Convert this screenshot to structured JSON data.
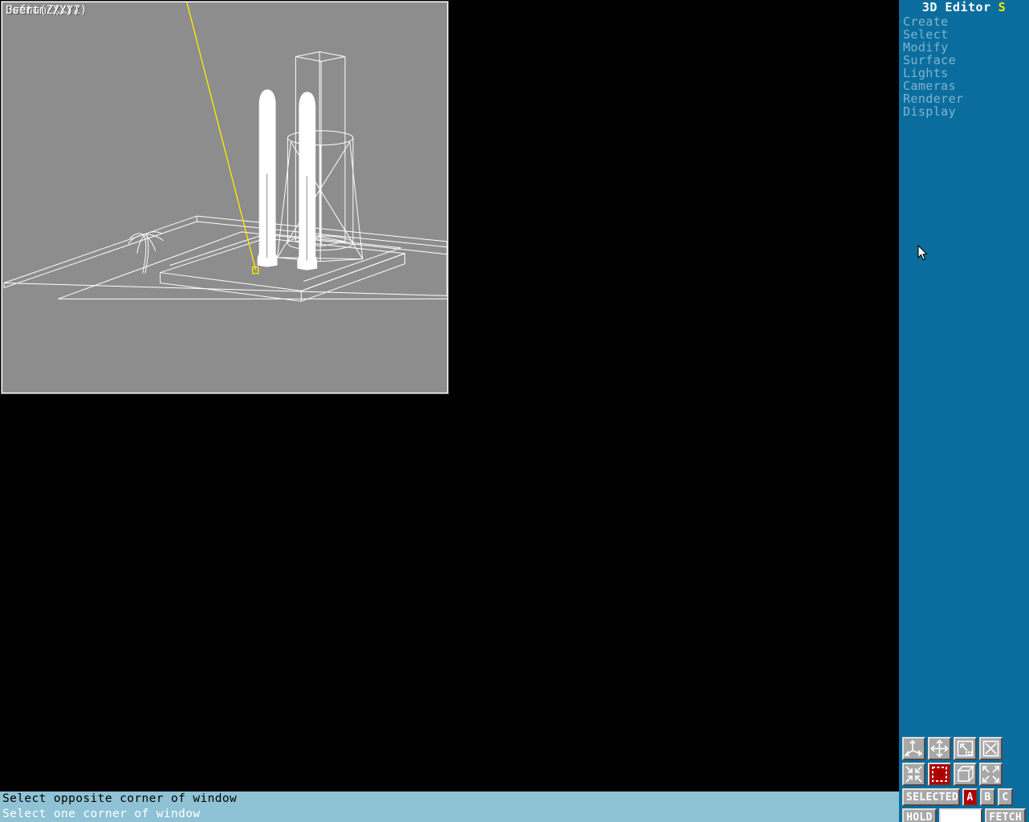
{
  "app": {
    "title": "3D Editor",
    "title_flag": "S"
  },
  "menu": {
    "items": [
      {
        "label": "Create"
      },
      {
        "label": "Select"
      },
      {
        "label": "Modify"
      },
      {
        "label": "Surface"
      },
      {
        "label": "Lights"
      },
      {
        "label": "Cameras"
      },
      {
        "label": "Renderer"
      },
      {
        "label": "Display"
      }
    ]
  },
  "viewports": [
    {
      "id": "bottom",
      "label": "Bottom (X/Z)"
    },
    {
      "id": "front",
      "label": "Front (X/Y)"
    },
    {
      "id": "left",
      "label": "Left (Z/Y)"
    },
    {
      "id": "user",
      "label": "User"
    }
  ],
  "status": {
    "line1": "Select opposite corner of window",
    "line2": "Select one corner of window"
  },
  "toolbox": {
    "row1": [
      {
        "name": "axis-tripod-icon",
        "title": "Axis"
      },
      {
        "name": "move-icon",
        "title": "Move"
      },
      {
        "name": "zoom-region-icon",
        "title": "Zoom region"
      },
      {
        "name": "cancel-box-icon",
        "title": "Cancel"
      }
    ],
    "row2": [
      {
        "name": "zoom-in-icon",
        "title": "Zoom in"
      },
      {
        "name": "selection-box-icon",
        "title": "Select box",
        "active": true
      },
      {
        "name": "cube-icon",
        "title": "Cube"
      },
      {
        "name": "zoom-out-icon",
        "title": "Zoom out"
      }
    ]
  },
  "buttons": {
    "selected": "SELECTED",
    "a": "A",
    "b": "B",
    "c": "C",
    "hold": "HOLD",
    "fetch": "FETCH",
    "swatch_value": ""
  },
  "colors": {
    "panel_bg": "#0b6d9e",
    "viewport_bg": "#8d8d8d",
    "wireframe": "#ffffff",
    "statusbar_bg": "#8fc2d4",
    "accent_red": "#b00000",
    "light_ray": "#ffe600",
    "menu_text": "#7fb4cd"
  }
}
